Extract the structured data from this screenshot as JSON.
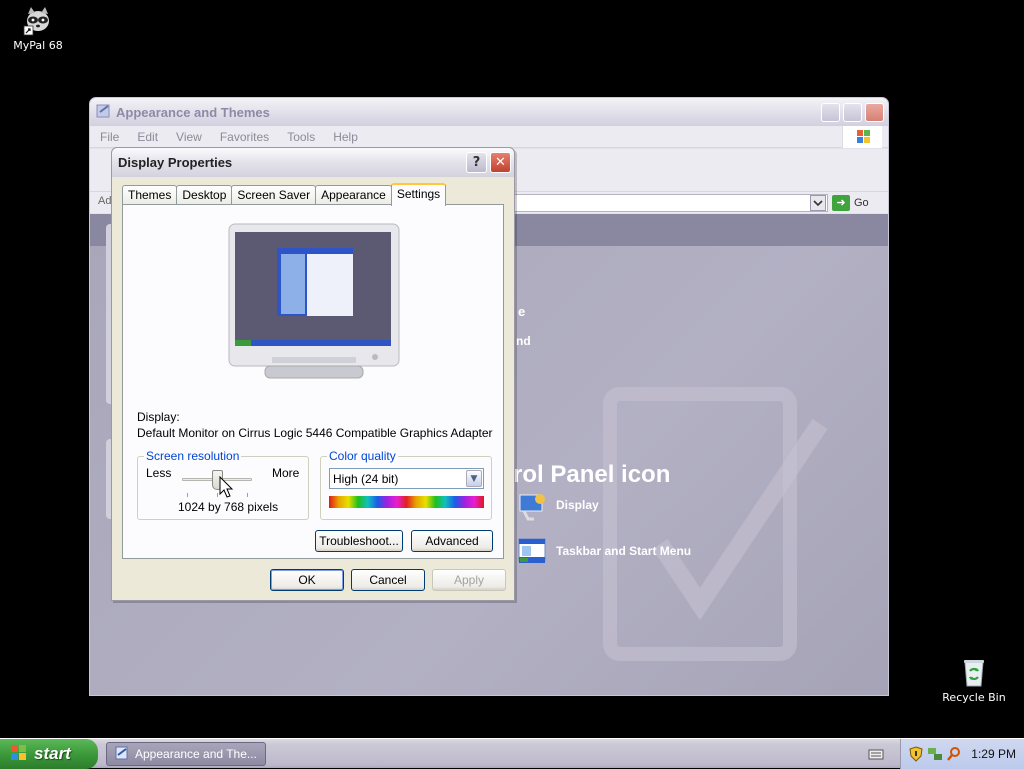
{
  "desktop": {
    "icons": [
      {
        "label": "MyPal 68",
        "icon": "raccoon-app-icon"
      },
      {
        "label": "Recycle Bin",
        "icon": "recycle-bin-icon"
      }
    ]
  },
  "background_window": {
    "title": "Appearance and Themes",
    "menu": [
      "File",
      "Edit",
      "View",
      "Favorites",
      "Tools",
      "Help"
    ],
    "address_label": "Ad",
    "go_label": "Go",
    "partial_texts": [
      "e",
      "nd"
    ],
    "heading_fragment": "rol Panel icon",
    "tasks": [
      {
        "label": "Display",
        "icon": "display-icon"
      },
      {
        "label": "Taskbar and Start Menu",
        "icon": "taskbar-icon"
      }
    ]
  },
  "dialog": {
    "title": "Display Properties",
    "tabs": [
      "Themes",
      "Desktop",
      "Screen Saver",
      "Appearance",
      "Settings"
    ],
    "active_tab": "Settings",
    "display_label": "Display:",
    "display_value": "Default Monitor on Cirrus Logic 5446 Compatible Graphics Adapter",
    "screen_resolution": {
      "legend": "Screen resolution",
      "less": "Less",
      "more": "More",
      "value_text": "1024 by 768 pixels",
      "slider_position": 0.5
    },
    "color_quality": {
      "legend": "Color quality",
      "selected": "High (24 bit)"
    },
    "buttons": {
      "troubleshoot": "Troubleshoot...",
      "advanced": "Advanced",
      "ok": "OK",
      "cancel": "Cancel",
      "apply": "Apply"
    }
  },
  "taskbar": {
    "start_label": "start",
    "task_item": "Appearance and The...",
    "clock": "1:29 PM"
  },
  "colors": {
    "desktop_bg": "#000000",
    "dialog_bg": "#ece9d8",
    "legend_blue": "#0046d5",
    "start_green": "#3c9a3a"
  }
}
